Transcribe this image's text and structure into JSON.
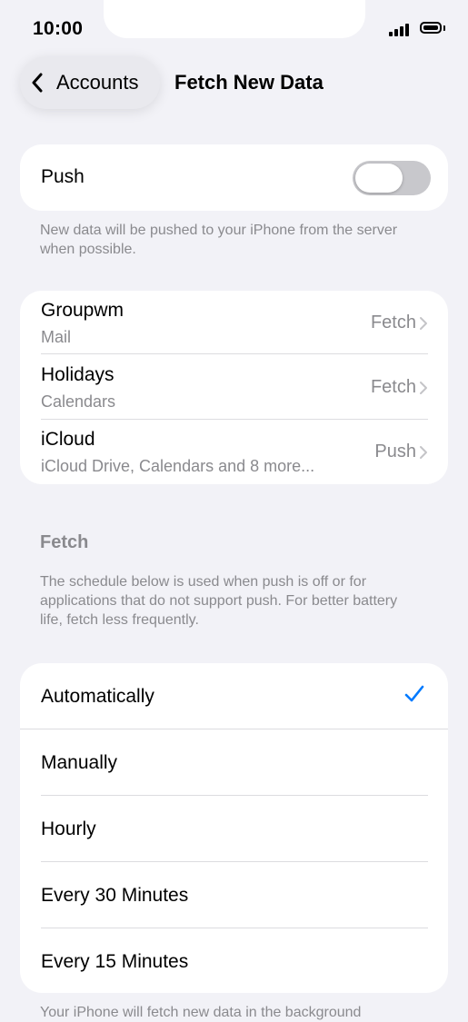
{
  "status_bar": {
    "time": "10:00"
  },
  "nav": {
    "back_label": "Accounts",
    "title": "Fetch New Data"
  },
  "push": {
    "label": "Push",
    "enabled": false,
    "footer": "New data will be pushed to your iPhone from the server when possible."
  },
  "accounts": [
    {
      "name": "Groupwm",
      "detail": "Mail",
      "value": "Fetch"
    },
    {
      "name": "Holidays",
      "detail": "Calendars",
      "value": "Fetch"
    },
    {
      "name": "iCloud",
      "detail": "iCloud Drive, Calendars and 8 more...",
      "value": "Push"
    }
  ],
  "fetch": {
    "header": "Fetch",
    "description": "The schedule below is used when push is off or for applications that do not support push. For better battery life, fetch less frequently.",
    "options": [
      "Automatically",
      "Manually",
      "Hourly",
      "Every 30 Minutes",
      "Every 15 Minutes"
    ],
    "selected": "Automatically",
    "footer": "Your iPhone will fetch new data in the background"
  },
  "colors": {
    "accent": "#007aff",
    "background": "#f2f2f7",
    "secondary_text": "#8a8a8e",
    "toggle_off": "#c8c8cc"
  },
  "icons": {
    "back": "chevron-left-icon",
    "disclosure": "chevron-right-icon",
    "selected": "checkmark-icon"
  }
}
